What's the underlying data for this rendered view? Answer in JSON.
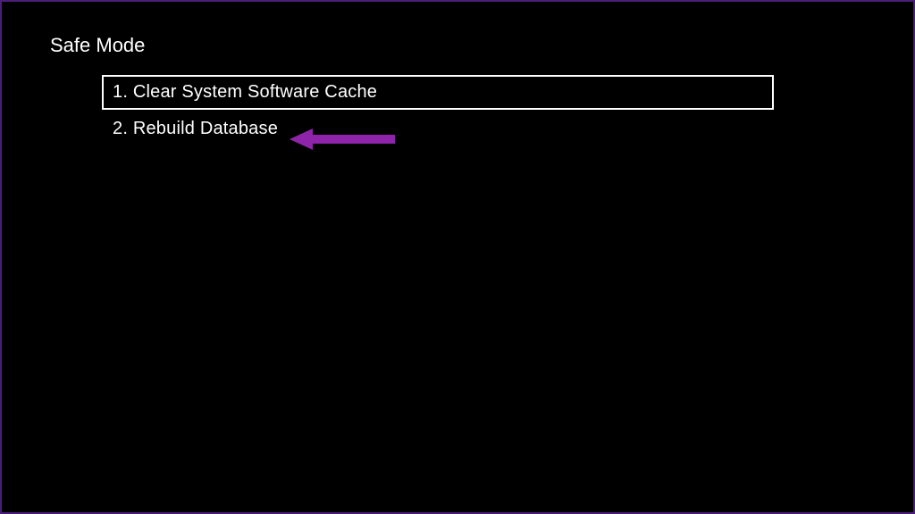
{
  "page_title": "Safe Mode",
  "menu": {
    "items": [
      {
        "label": "1. Clear System Software Cache",
        "selected": true
      },
      {
        "label": "2. Rebuild Database",
        "selected": false
      }
    ]
  },
  "annotation": {
    "arrow_color": "#8e24aa"
  }
}
